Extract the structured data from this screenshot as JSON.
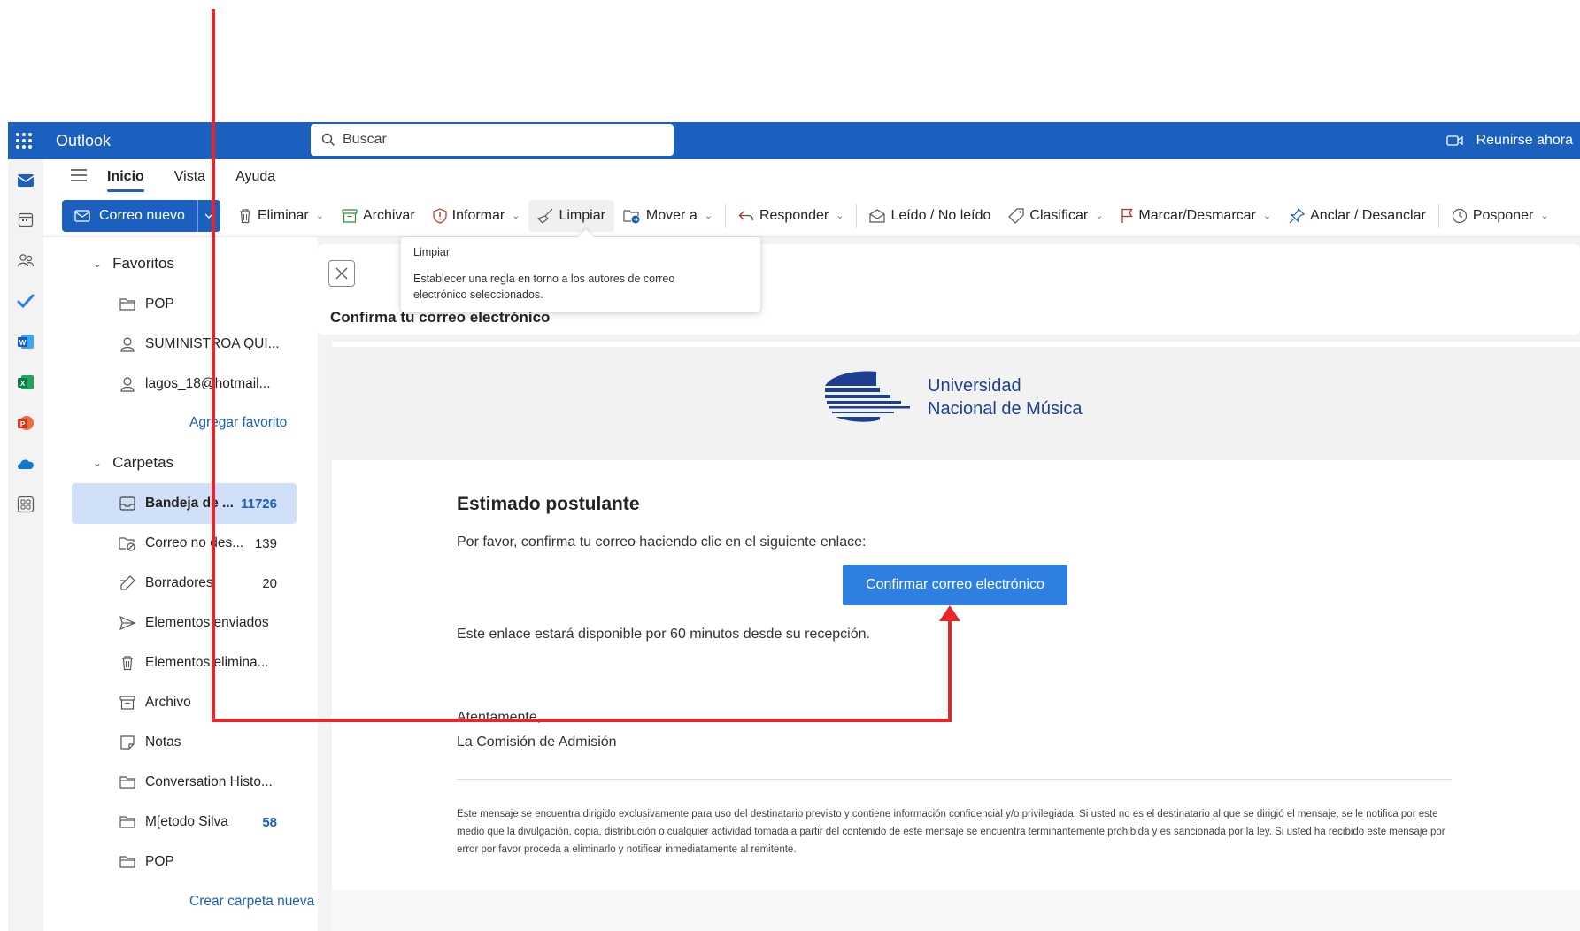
{
  "app": {
    "title": "Outlook"
  },
  "search": {
    "placeholder": "Buscar"
  },
  "meet": {
    "label": "Reunirse ahora"
  },
  "tabs": [
    {
      "label": "Inicio",
      "active": true
    },
    {
      "label": "Vista"
    },
    {
      "label": "Ayuda"
    }
  ],
  "commands": {
    "new_mail": "Correo nuevo",
    "delete": "Eliminar",
    "archive": "Archivar",
    "report": "Informar",
    "sweep": "Limpiar",
    "move": "Mover a",
    "reply": "Responder",
    "read_unread": "Leído / No leído",
    "categorize": "Clasificar",
    "flag": "Marcar/Desmarcar",
    "pin": "Anclar / Desanclar",
    "snooze": "Posponer"
  },
  "tooltip": {
    "title": "Limpiar",
    "description": "Establecer una regla en torno a los autores de correo electrónico seleccionados."
  },
  "folders": {
    "favorites_label": "Favoritos",
    "favorites": [
      {
        "label": "POP",
        "icon": "folder-icon"
      },
      {
        "label": "SUMINISTROA QUI...",
        "icon": "person-icon"
      },
      {
        "label": "lagos_18@hotmail...",
        "icon": "person-icon"
      }
    ],
    "add_favorite": "Agregar favorito",
    "folders_label": "Carpetas",
    "items": [
      {
        "label": "Bandeja de ...",
        "count": "11726",
        "icon": "inbox-icon",
        "selected": true
      },
      {
        "label": "Correo no des...",
        "count": "139",
        "icon": "junk-icon"
      },
      {
        "label": "Borradores",
        "count": "20",
        "icon": "drafts-icon"
      },
      {
        "label": "Elementos enviados",
        "count": "",
        "icon": "sent-icon"
      },
      {
        "label": "Elementos elimina...",
        "count": "",
        "icon": "trash-icon"
      },
      {
        "label": "Archivo",
        "count": "",
        "icon": "archive-icon"
      },
      {
        "label": "Notas",
        "count": "",
        "icon": "notes-icon"
      },
      {
        "label": "Conversation Histo...",
        "count": "",
        "icon": "folder-icon"
      },
      {
        "label": "M[etodo Silva",
        "count": "58",
        "icon": "folder-icon"
      },
      {
        "label": "POP",
        "count": "",
        "icon": "folder-icon"
      }
    ],
    "create_folder": "Crear carpeta nueva"
  },
  "message": {
    "subject": "Confirma tu correo electrónico",
    "logo_line1": "Universidad",
    "logo_line2": "Nacional de Música",
    "greeting": "Estimado postulante",
    "body_line1": "Por favor, confirma tu correo haciendo clic en el siguiente enlace:",
    "confirm_button": "Confirmar correo electrónico",
    "body_line2": "Este enlace estará disponible por 60 minutos desde su recepción.",
    "signoff": "Atentamente,",
    "signature": "La Comisión de Admisión",
    "disclaimer": "Este mensaje se encuentra dirigido exclusivamente para uso del destinatario previsto y contiene información confidencial y/o privilegiada. Si usted no es el destinatario al que se dirigió el mensaje, se le notifica por este medio que la divulgación, copia, distribución o cualquier actividad tomada a partir del contenido de este mensaje se encuentra terminantemente prohibida y es sancionada por la ley. Si usted ha recibido este mensaje por error por favor proceda a eliminarlo y notificar inmediatamente al remitente."
  },
  "colors": {
    "brand": "#1b5fbf",
    "button": "#2f7fe0",
    "annotation": "#e8262a",
    "logo": "#1e3f8f"
  }
}
